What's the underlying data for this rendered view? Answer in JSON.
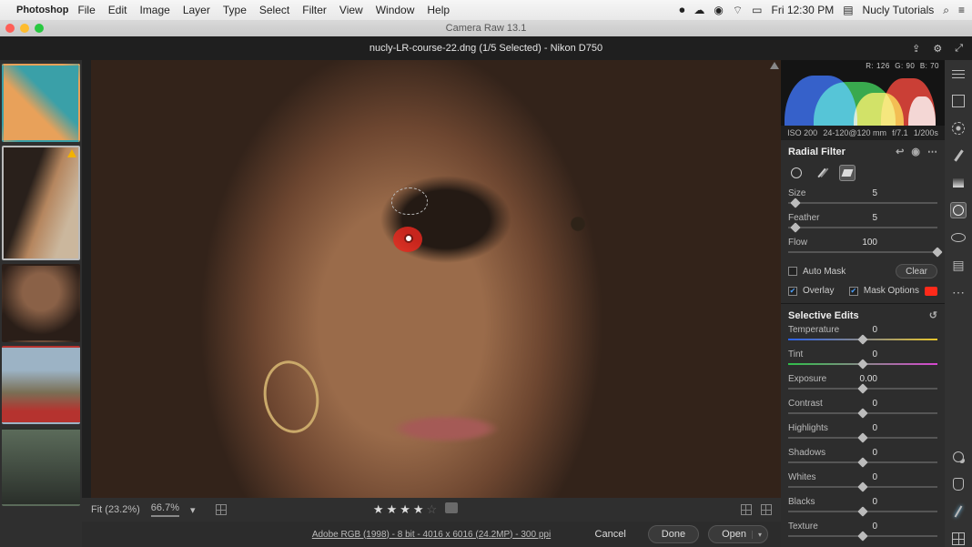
{
  "mac": {
    "app": "Photoshop",
    "menu": [
      "File",
      "Edit",
      "Image",
      "Layer",
      "Type",
      "Select",
      "Filter",
      "View",
      "Window",
      "Help"
    ],
    "clock": "Fri 12:30 PM",
    "user": "Nucly Tutorials"
  },
  "window": {
    "title": "Camera Raw 13.1"
  },
  "doc": {
    "title": "nucly-LR-course-22.dng (1/5 Selected)  -  Nikon D750"
  },
  "histogram": {
    "r": "R: 126",
    "g": "G: 90",
    "b": "B: 70"
  },
  "exif": {
    "iso": "ISO 200",
    "lens": "24-120@120 mm",
    "aperture": "f/7.1",
    "shutter": "1/200s"
  },
  "panel": {
    "title": "Radial Filter",
    "sliders": {
      "size": {
        "label": "Size",
        "value": "5"
      },
      "feather": {
        "label": "Feather",
        "value": "5"
      },
      "flow": {
        "label": "Flow",
        "value": "100"
      }
    },
    "automask": "Auto Mask",
    "clear": "Clear",
    "overlay": "Overlay",
    "maskopts": "Mask Options"
  },
  "selective": {
    "title": "Selective Edits",
    "temperature": {
      "label": "Temperature",
      "value": "0"
    },
    "tint": {
      "label": "Tint",
      "value": "0"
    },
    "exposure": {
      "label": "Exposure",
      "value": "0.00"
    },
    "contrast": {
      "label": "Contrast",
      "value": "0"
    },
    "highlights": {
      "label": "Highlights",
      "value": "0"
    },
    "shadows": {
      "label": "Shadows",
      "value": "0"
    },
    "whites": {
      "label": "Whites",
      "value": "0"
    },
    "blacks": {
      "label": "Blacks",
      "value": "0"
    },
    "texture": {
      "label": "Texture",
      "value": "0"
    }
  },
  "footer": {
    "fit": "Fit (23.2%)",
    "zoom": "66.7%",
    "meta": "Adobe RGB (1998) - 8 bit - 4016 x 6016 (24.2MP) - 300 ppi",
    "cancel": "Cancel",
    "done": "Done",
    "open": "Open"
  }
}
